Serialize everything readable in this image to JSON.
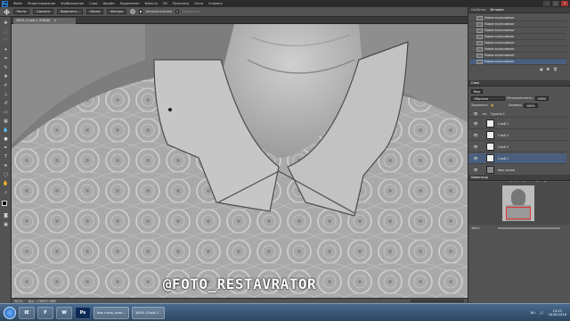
{
  "app": {
    "logo": "Ps"
  },
  "menu": [
    "Файл",
    "Редактирование",
    "Изображение",
    "Слои",
    "Шрифт",
    "Выделение",
    "Фильтр",
    "3D",
    "Просмотр",
    "Окно",
    "Справка"
  ],
  "window_controls": {
    "minimize": "–",
    "maximize": "□",
    "close": "✕"
  },
  "options_bar": {
    "tool_icon": "move-tool-icon",
    "buttons": [
      "Растр",
      "Сделать",
      "Выделить..."
    ],
    "style_label": "Маска",
    "style_value": "Фигуры",
    "checkbox_label": "Автоматическое",
    "dim_label": "Выровнять"
  },
  "document_tab": {
    "title": "300% (Слой 1, RGB/8)",
    "close": "×"
  },
  "canvas": {
    "watermark": "@FOTO_RESTAVRATOR"
  },
  "status": {
    "zoom": "300%",
    "doc": "Док: 1,98M/7,88M"
  },
  "history_panel": {
    "tabs": [
      "Свойства",
      "История"
    ],
    "active_tab": 1,
    "items": [
      "Новое агрессивное",
      "Новое агрессивное",
      "Новое агрессивное",
      "Новое агрессивное",
      "Новое агрессивное",
      "Новое агрессивное",
      "Новое агрессивное",
      "Новое агрессивное"
    ],
    "selected": 7
  },
  "layers_panel": {
    "tabs": [
      "Слои"
    ],
    "kind_value": "Вид",
    "blend_mode": "Обычные",
    "opacity_label": "Непрозрачность:",
    "opacity_value": "100%",
    "lock_label": "Закрепить:",
    "fill_label": "Заливка:",
    "fill_value": "100%",
    "group_name": "Группа 1",
    "layers": [
      "Слой 1",
      "Слой 3",
      "Слой 2",
      "Слой 1",
      "Фон копия"
    ],
    "selected": 3
  },
  "navigator_panel": {
    "title": "Навигатор",
    "zoom": "300%"
  },
  "taskbar": {
    "start_icon": "windows-start-icon",
    "apps": [
      "IE",
      "F",
      "W",
      "Ps"
    ],
    "tasks": [
      "Как стать успе...",
      "300% (Слой 1..."
    ],
    "language": "RU",
    "time": "13:23",
    "date": "16.08.2016"
  }
}
